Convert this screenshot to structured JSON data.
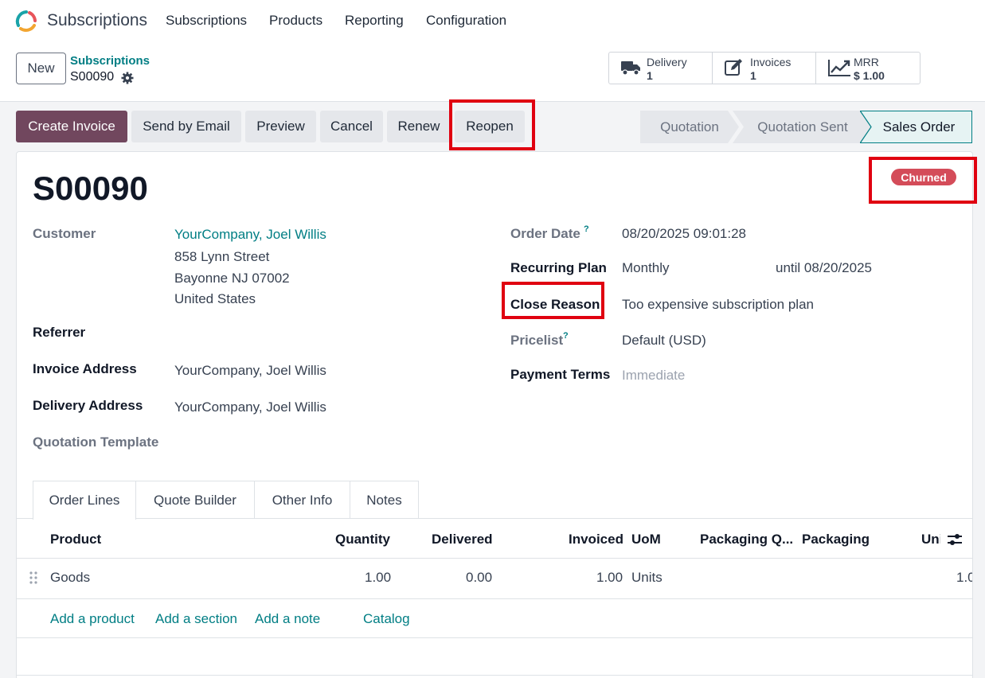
{
  "app": {
    "name": "Subscriptions"
  },
  "nav": {
    "items": [
      "Subscriptions",
      "Products",
      "Reporting",
      "Configuration"
    ]
  },
  "control": {
    "new_label": "New",
    "breadcrumb_parent": "Subscriptions",
    "breadcrumb_current": "S00090"
  },
  "smart_buttons": [
    {
      "label": "Delivery",
      "value": "1",
      "icon": "truck-icon"
    },
    {
      "label": "Invoices",
      "value": "1",
      "icon": "edit-invoice-icon"
    },
    {
      "label": "MRR",
      "value": "$ 1.00",
      "icon": "chart-line-icon"
    }
  ],
  "actions": {
    "create_invoice": "Create Invoice",
    "send_email": "Send by Email",
    "preview": "Preview",
    "cancel": "Cancel",
    "renew": "Renew",
    "reopen": "Reopen"
  },
  "statusbar": {
    "stages": [
      "Quotation",
      "Quotation Sent",
      "Sales Order"
    ],
    "active": "Sales Order"
  },
  "record": {
    "title": "S00090",
    "badge": "Churned",
    "customer_label": "Customer",
    "customer_name": "YourCompany, Joel Willis",
    "customer_address": [
      "858 Lynn Street",
      "Bayonne NJ 07002",
      "United States"
    ],
    "referrer_label": "Referrer",
    "invoice_address_label": "Invoice Address",
    "invoice_address": "YourCompany, Joel Willis",
    "delivery_address_label": "Delivery Address",
    "delivery_address": "YourCompany, Joel Willis",
    "quotation_template_label": "Quotation Template",
    "order_date_label": "Order Date",
    "order_date": "08/20/2025 09:01:28",
    "recurring_plan_label": "Recurring Plan",
    "recurring_plan": "Monthly",
    "until": "until 08/20/2025",
    "close_reason_label": "Close Reason",
    "close_reason": "Too expensive subscription plan",
    "pricelist_label": "Pricelist",
    "pricelist": "Default (USD)",
    "payment_terms_label": "Payment Terms",
    "payment_terms": "Immediate",
    "help_mark": "?"
  },
  "tabs": [
    "Order Lines",
    "Quote Builder",
    "Other Info",
    "Notes"
  ],
  "table": {
    "headers": [
      "Product",
      "Quantity",
      "Delivered",
      "Invoiced",
      "UoM",
      "Packaging Q...",
      "Packaging",
      "Uni"
    ],
    "rows": [
      {
        "product": "Goods",
        "quantity": "1.00",
        "delivered": "0.00",
        "invoiced": "1.00",
        "uom": "Units",
        "unit": "1.0"
      }
    ],
    "add_links": [
      "Add a product",
      "Add a section",
      "Add a note",
      "Catalog"
    ]
  },
  "colors": {
    "primary": "#71475e",
    "link": "#017e84",
    "badge": "#d44c59",
    "highlight": "#e00010"
  }
}
